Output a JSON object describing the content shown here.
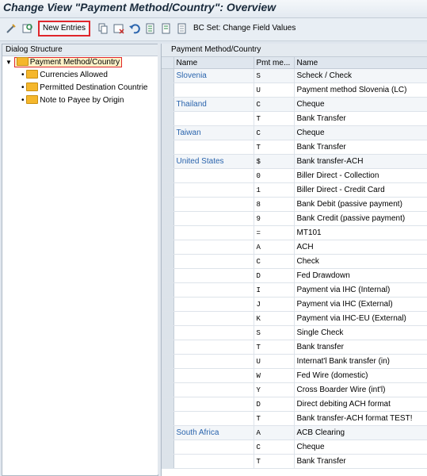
{
  "window": {
    "title": "Change View \"Payment Method/Country\": Overview"
  },
  "toolbar": {
    "new_entries_label": "New Entries",
    "bcset_label": "BC Set: Change Field Values"
  },
  "dialog_structure": {
    "header": "Dialog Structure",
    "root": "Payment Method/Country",
    "children": [
      "Currencies Allowed",
      "Permitted Destination Countrie",
      "Note to Payee by Origin"
    ]
  },
  "table": {
    "title": "Payment Method/Country",
    "headers": [
      "Name",
      "Pmt me...",
      "Name"
    ],
    "rows": [
      [
        "Slovenia",
        "S",
        "Scheck / Check"
      ],
      [
        "",
        "U",
        "Payment method Slovenia (LC)"
      ],
      [
        "Thailand",
        "C",
        "Cheque"
      ],
      [
        "",
        "T",
        "Bank Transfer"
      ],
      [
        "Taiwan",
        "C",
        "Cheque"
      ],
      [
        "",
        "T",
        "Bank Transfer"
      ],
      [
        "United States",
        "$",
        "Bank transfer-ACH"
      ],
      [
        "",
        "0",
        "Biller Direct - Collection"
      ],
      [
        "",
        "1",
        "Biller Direct - Credit Card"
      ],
      [
        "",
        "8",
        "Bank Debit (passive payment)"
      ],
      [
        "",
        "9",
        "Bank Credit (passive payment)"
      ],
      [
        "",
        "=",
        "MT101"
      ],
      [
        "",
        "A",
        "ACH"
      ],
      [
        "",
        "C",
        "Check"
      ],
      [
        "",
        "D",
        "Fed Drawdown"
      ],
      [
        "",
        "I",
        "Payment via IHC (Internal)"
      ],
      [
        "",
        "J",
        "Payment via IHC (External)"
      ],
      [
        "",
        "K",
        "Payment via IHC-EU (External)"
      ],
      [
        "",
        "S",
        "Single Check"
      ],
      [
        "",
        "T",
        "Bank transfer"
      ],
      [
        "",
        "U",
        "Internat'l Bank transfer (in)"
      ],
      [
        "",
        "W",
        "Fed Wire (domestic)"
      ],
      [
        "",
        "Y",
        "Cross Boarder Wire (int'l)"
      ],
      [
        "",
        "D",
        "Direct debiting ACH format"
      ],
      [
        "",
        "T",
        "Bank transfer-ACH format TEST!"
      ],
      [
        "South Africa",
        "A",
        "ACB Clearing"
      ],
      [
        "",
        "C",
        "Cheque"
      ],
      [
        "",
        "T",
        "Bank Transfer"
      ]
    ]
  }
}
